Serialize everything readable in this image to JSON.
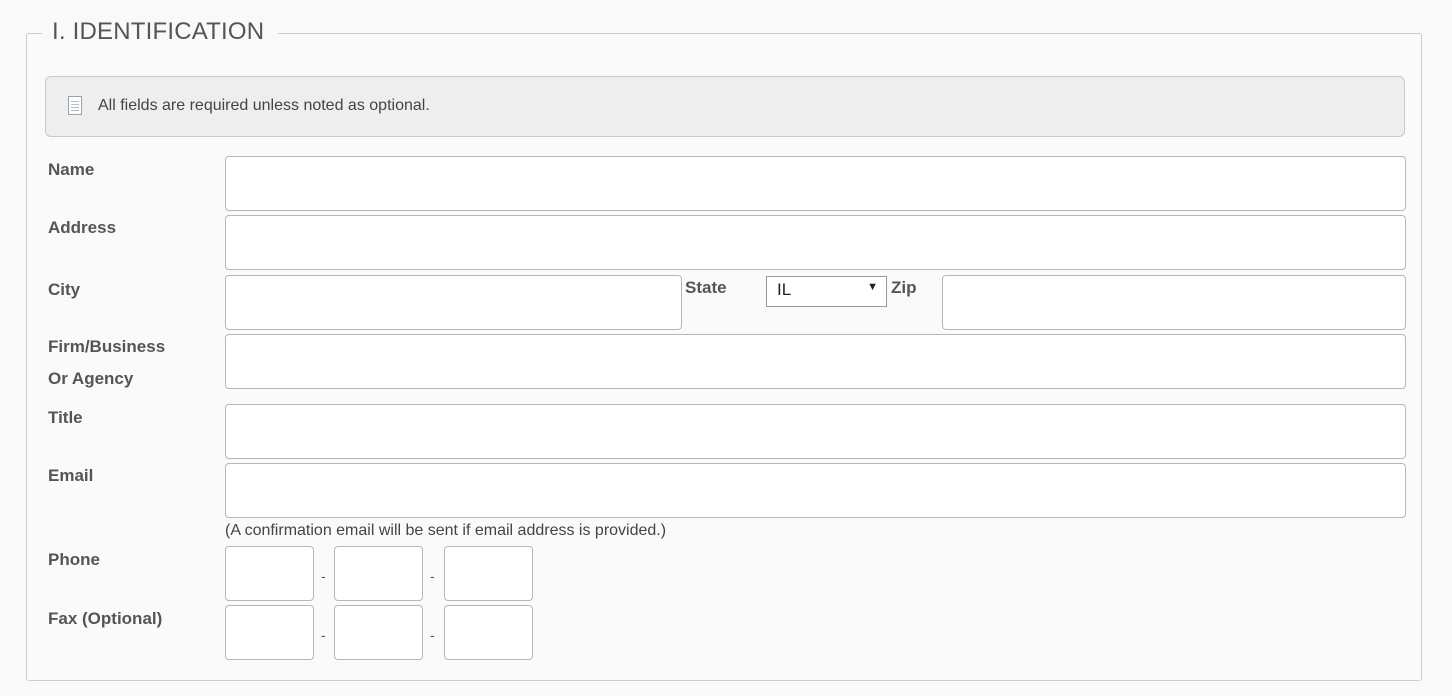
{
  "section": {
    "legend": "I. IDENTIFICATION",
    "notice": "All fields are required unless noted as optional.",
    "notice_icon": "document-icon"
  },
  "fields": {
    "name": {
      "label": "Name",
      "value": ""
    },
    "address": {
      "label": "Address",
      "value": ""
    },
    "city": {
      "label": "City",
      "value": ""
    },
    "state": {
      "label": "State",
      "selected": "IL"
    },
    "zip": {
      "label": "Zip",
      "value": ""
    },
    "firm": {
      "label_line1": "Firm/Business",
      "label_line2": "Or Agency",
      "value": ""
    },
    "title": {
      "label": "Title",
      "value": ""
    },
    "email": {
      "label": "Email",
      "value": "",
      "note": "(A confirmation email will be sent if email address is provided.)"
    },
    "phone": {
      "label": "Phone",
      "separator": "-"
    },
    "fax": {
      "label": "Fax (Optional)",
      "separator": "-"
    }
  },
  "colors": {
    "border": "#c3cfda",
    "notice_bg": "#eeeeee",
    "input_border": "#b6b6b6"
  }
}
